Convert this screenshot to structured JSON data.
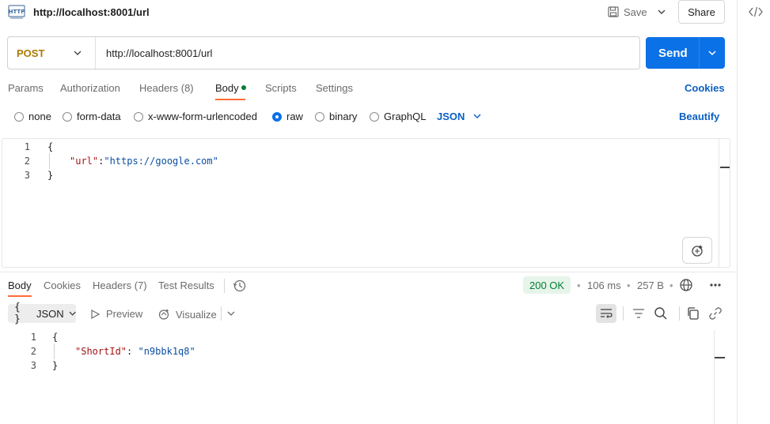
{
  "request": {
    "title": "http://localhost:8001/url",
    "method": "POST",
    "url": "http://localhost:8001/url",
    "save_label": "Save",
    "share_label": "Share",
    "send_label": "Send"
  },
  "request_tabs": {
    "params": "Params",
    "authorization": "Authorization",
    "headers": "Headers (8)",
    "body": "Body",
    "scripts": "Scripts",
    "settings": "Settings",
    "cookies": "Cookies"
  },
  "body_modes": {
    "none": "none",
    "form_data": "form-data",
    "urlencoded": "x-www-form-urlencoded",
    "raw": "raw",
    "binary": "binary",
    "graphql": "GraphQL",
    "selected": "raw",
    "language": "JSON",
    "beautify": "Beautify"
  },
  "request_body": {
    "line_numbers": [
      "1",
      "2",
      "3"
    ],
    "open_brace": "{",
    "key": "\"url\"",
    "colon": ":",
    "value": "\"https://google.com\"",
    "close_brace": "}"
  },
  "response_tabs": {
    "body": "Body",
    "cookies": "Cookies",
    "headers": "Headers (7)",
    "test_results": "Test Results"
  },
  "response_meta": {
    "status": "200 OK",
    "time": "106 ms",
    "size": "257 B",
    "separator": "•"
  },
  "response_toolbar": {
    "format_icon": "{ }",
    "format": "JSON",
    "preview": "Preview",
    "visualize": "Visualize"
  },
  "response_body": {
    "line_numbers": [
      "1",
      "2",
      "3"
    ],
    "open_brace": "{",
    "key": "\"ShortId\"",
    "colon": ": ",
    "value": "\"n9bbk1q8\"",
    "close_brace": "}"
  },
  "colors": {
    "send": "#0b71e6",
    "method": "#ad7a03",
    "accent_tab": "#ff6c37",
    "status_ok": "#007f31",
    "link": "#0b5fc4"
  }
}
